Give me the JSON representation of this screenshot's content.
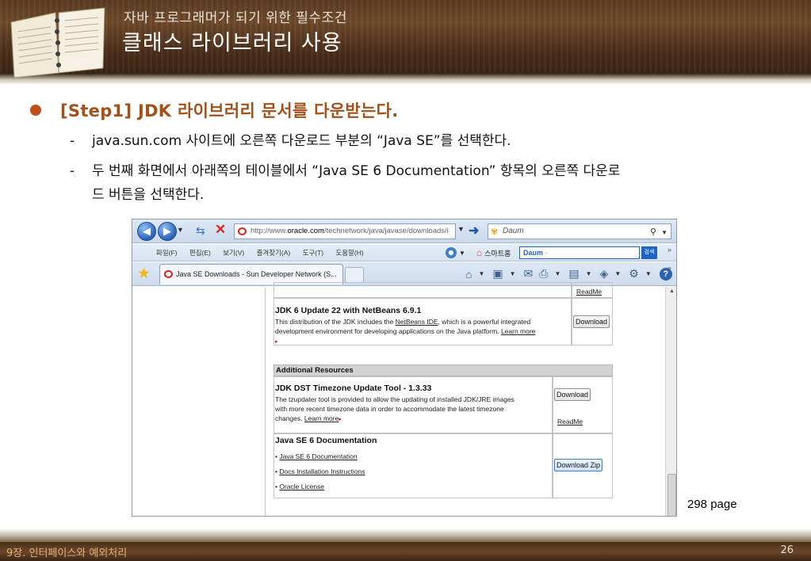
{
  "header": {
    "subtitle": "자바 프로그래머가 되기 위한 필수조건",
    "title": "클래스 라이브러리 사용"
  },
  "step": {
    "title": "[Step1] JDK 라이브러리 문서를 다운받는다.",
    "items": [
      {
        "dash": "-",
        "text": "java.sun.com 사이트에 오른쪽 다운로드 부분의 “Java SE”를 선택한다."
      },
      {
        "dash": "-",
        "text": "두 번째 화면에서 아래쪽의 테이블에서 “Java SE 6 Documentation” 항목의 오른쪽 다운로",
        "text2": "드 버튼을 선택한다."
      }
    ]
  },
  "browser": {
    "address_prefix": "http://www.",
    "address_domain": "oracle.com",
    "address_suffix": "/technetwork/java/javase/downloads/i",
    "search_text": "Daum",
    "menu": [
      "파일(F)",
      "편집(E)",
      "보기(V)",
      "즐겨찾기(A)",
      "도구(T)",
      "도움말(H)"
    ],
    "smart_home": "스마트홈",
    "daum_logo": "Daum",
    "daum_search_label": "검색",
    "tab_title": "Java SE Downloads - Sun Developer Network (S..."
  },
  "page": {
    "readme_top": "ReadMe",
    "netbeans": {
      "title": "JDK 6 Update 22 with NetBeans 6.9.1",
      "desc_1": "This distribution of the JDK includes the ",
      "desc_link": "NetBeans IDE",
      "desc_2": ", which is a powerful integrated",
      "desc_3": "development environment for developing applications on the Java platform.",
      "learn_more": "Learn more",
      "button": "Download"
    },
    "additional": {
      "header": "Additional Resources",
      "dst": {
        "title": "JDK DST Timezone Update Tool - 1.3.33",
        "desc_1": "The tzupdater tool is provided to allow the updating of installed JDK/JRE images",
        "desc_2": "with more recent timezone data in order to accommodate the latest timezone",
        "desc_3": "changes.",
        "learn_more": "Learn more",
        "button": "Download",
        "readme": "ReadMe"
      },
      "docs": {
        "title": "Java SE 6 Documentation",
        "links": [
          "Java SE 6 Documentation",
          "Docs Installation Instructions",
          "Oracle License"
        ],
        "button": "Download Zip"
      }
    }
  },
  "page_ref": "298 page",
  "footer": {
    "chapter": "9장. 인터페이스와 예외처리",
    "page_number": "26"
  }
}
